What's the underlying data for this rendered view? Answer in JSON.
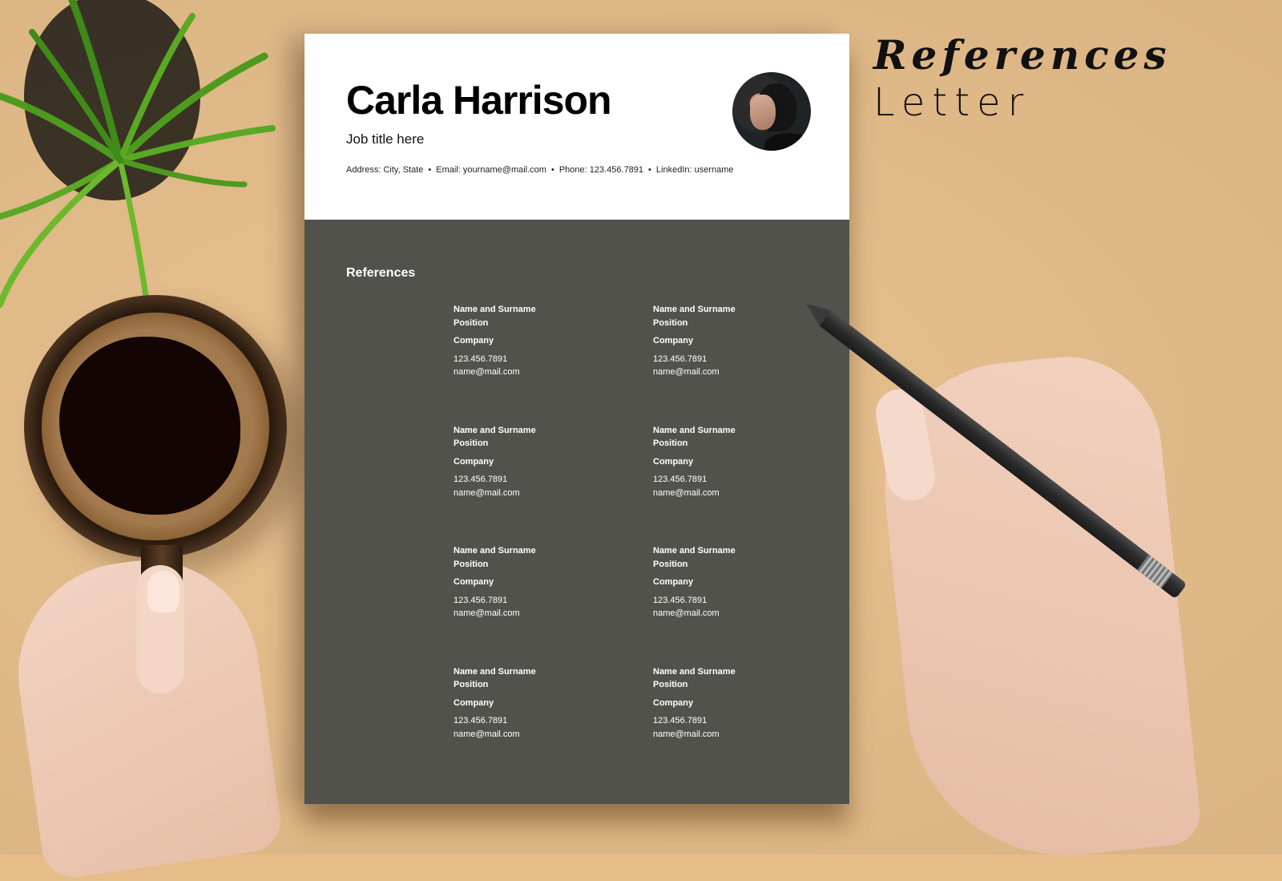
{
  "promo": {
    "title_script": "References",
    "title_sub": "Letter"
  },
  "resume": {
    "name": "Carla Harrison",
    "job_title": "Job title here",
    "contact": {
      "address": "Address: City, State",
      "email": "Email: yourname@mail.com",
      "phone": "Phone: 123.456.7891",
      "linkedin": "LinkedIn: username",
      "separator": "•"
    },
    "photo_alt": "profile-photo",
    "section_title": "References",
    "references": [
      {
        "name": "Name and Surname",
        "position": "Position",
        "company": "Company",
        "phone": "123.456.7891",
        "email": "name@mail.com"
      },
      {
        "name": "Name and Surname",
        "position": "Position",
        "company": "Company",
        "phone": "123.456.7891",
        "email": "name@mail.com"
      },
      {
        "name": "Name and Surname",
        "position": "Position",
        "company": "Company",
        "phone": "123.456.7891",
        "email": "name@mail.com"
      },
      {
        "name": "Name and Surname",
        "position": "Position",
        "company": "Company",
        "phone": "123.456.7891",
        "email": "name@mail.com"
      },
      {
        "name": "Name and Surname",
        "position": "Position",
        "company": "Company",
        "phone": "123.456.7891",
        "email": "name@mail.com"
      },
      {
        "name": "Name and Surname",
        "position": "Position",
        "company": "Company",
        "phone": "123.456.7891",
        "email": "name@mail.com"
      },
      {
        "name": "Name and Surname",
        "position": "Position",
        "company": "Company",
        "phone": "123.456.7891",
        "email": "name@mail.com"
      },
      {
        "name": "Name and Surname",
        "position": "Position",
        "company": "Company",
        "phone": "123.456.7891",
        "email": "name@mail.com"
      }
    ]
  },
  "colors": {
    "background": "#e6bd89",
    "header_bg": "#ffffff",
    "body_bg": "#52524d",
    "text_light": "#ffffff",
    "text_dark": "#000000"
  }
}
